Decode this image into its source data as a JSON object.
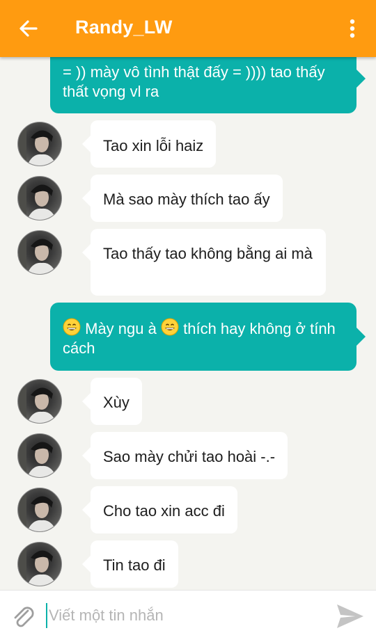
{
  "header": {
    "title": "Randy_LW",
    "back_icon": "arrow-left-icon",
    "menu_icon": "more-vertical-icon",
    "color": "#ff9b10"
  },
  "messages": [
    {
      "from": "me",
      "text": "= )) mày vô tình thật đấy = )))) tao thấy thất vọng vl ra"
    },
    {
      "from": "them",
      "text": "Tao xin lỗi haiz"
    },
    {
      "from": "them",
      "text": "Mà sao mày thích tao ấy"
    },
    {
      "from": "them",
      "text": "Tao thấy tao không bằng ai mà"
    },
    {
      "from": "me",
      "text_a": "Mày ngu à",
      "text_b": "thích hay không ở tính cách",
      "emoji": "grinning-face-icon"
    },
    {
      "from": "them",
      "text": "Xùy"
    },
    {
      "from": "them",
      "text": "Sao mày chửi tao hoài -.-"
    },
    {
      "from": "them",
      "text": "Cho tao xin acc đi"
    },
    {
      "from": "them",
      "text": "Tin tao đi"
    }
  ],
  "composer": {
    "placeholder": "Viết một tin nhắn",
    "value": "",
    "attach_icon": "paperclip-icon",
    "send_icon": "send-icon"
  },
  "colors": {
    "accent": "#ff9b10",
    "outgoing_bubble": "#0bb1aa",
    "incoming_bubble": "#ffffff",
    "background": "#f4f4f0"
  }
}
